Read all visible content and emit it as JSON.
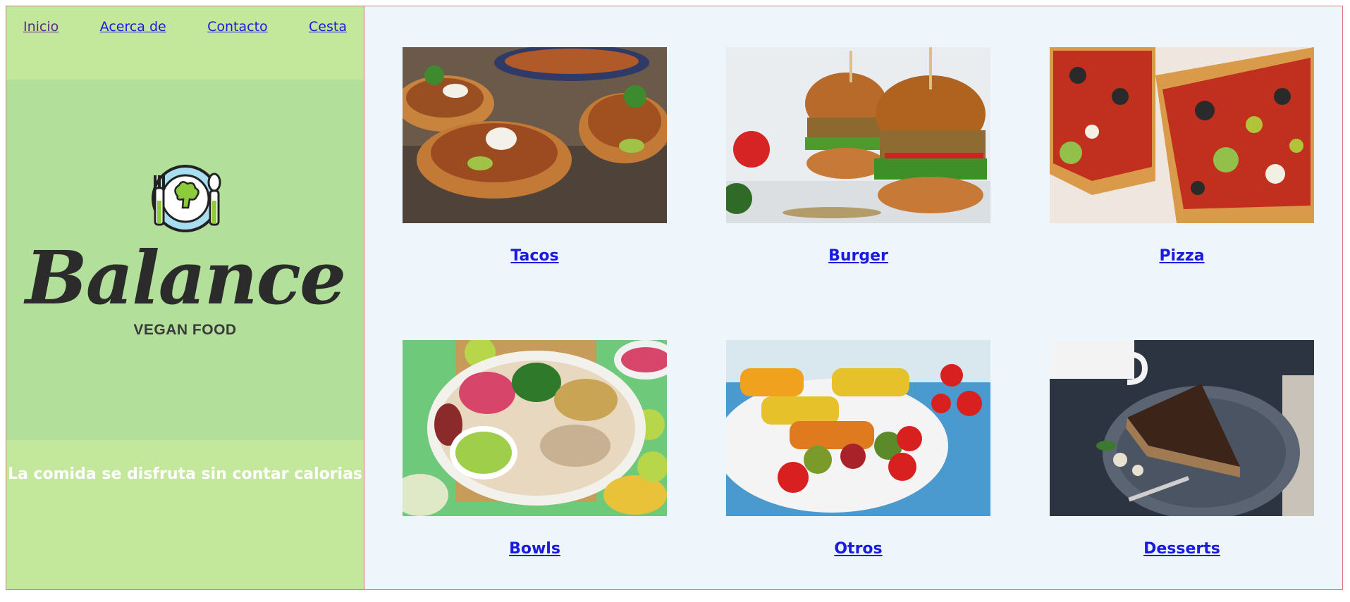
{
  "nav": {
    "items": [
      {
        "label": "Inicio"
      },
      {
        "label": "Acerca de"
      },
      {
        "label": "Contacto"
      },
      {
        "label": "Cesta"
      }
    ]
  },
  "brand": {
    "name": "Balance",
    "subtitle": "VEGAN FOOD",
    "icon": "plate-fork-spoon-broccoli-icon"
  },
  "tagline": "La comida se disfruta sin contar calorias",
  "menu": {
    "items": [
      {
        "label": "Tacos",
        "icon": "tacos-photo"
      },
      {
        "label": "Burger",
        "icon": "burger-photo"
      },
      {
        "label": "Pizza",
        "icon": "pizza-photo"
      },
      {
        "label": "Bowls",
        "icon": "bowl-photo"
      },
      {
        "label": "Otros",
        "icon": "skewers-photo"
      },
      {
        "label": "Desserts",
        "icon": "dessert-photo"
      }
    ]
  },
  "colors": {
    "sidebar": "#c3e89b",
    "logo_panel": "#b2e09a",
    "main_bg": "#eef6fc",
    "link": "#1a1ae0",
    "border": "#e0737d"
  }
}
